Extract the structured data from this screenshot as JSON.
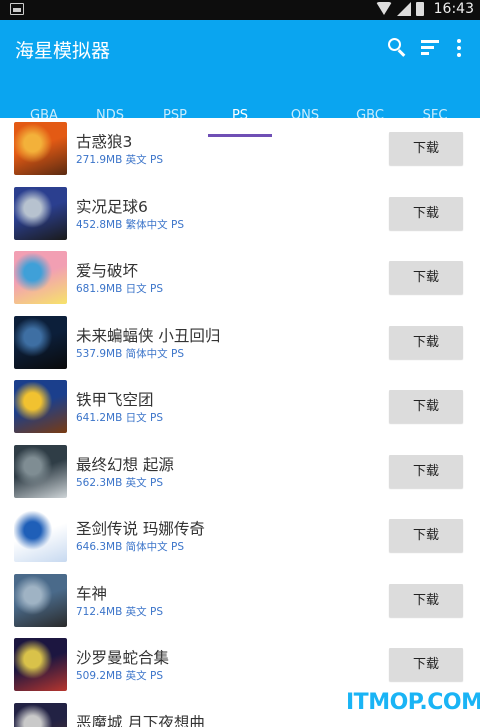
{
  "status_bar": {
    "time": "16:43"
  },
  "app_bar": {
    "title": "海星模拟器",
    "color": "#0aa5f0",
    "icons": [
      "search-icon",
      "sort-icon",
      "more-vert-icon"
    ]
  },
  "tabs": [
    {
      "label": "GBA",
      "active": false
    },
    {
      "label": "NDS",
      "active": false
    },
    {
      "label": "PSP",
      "active": false
    },
    {
      "label": "PS",
      "active": true
    },
    {
      "label": "ONS",
      "active": false
    },
    {
      "label": "GBC",
      "active": false
    },
    {
      "label": "SFC",
      "active": false
    }
  ],
  "download_label": "下载",
  "games": [
    {
      "name": "古惑狼3",
      "size": "271.9MB",
      "lang": "英文",
      "platform": "PS",
      "palette": [
        "#e35a14",
        "#f3b13a",
        "#5a2a12"
      ]
    },
    {
      "name": "实况足球6",
      "size": "452.8MB",
      "lang": "繁体中文",
      "platform": "PS",
      "palette": [
        "#2b3f8f",
        "#b7c2cf",
        "#1a1a1a"
      ]
    },
    {
      "name": "爱与破坏",
      "size": "681.9MB",
      "lang": "日文",
      "platform": "PS",
      "palette": [
        "#f29fb3",
        "#3fa0d8",
        "#f6e36a"
      ]
    },
    {
      "name": "未来蝙蝠侠 小丑回归",
      "size": "537.9MB",
      "lang": "简体中文",
      "platform": "PS",
      "palette": [
        "#0c1f3a",
        "#3e6fa3",
        "#0a0a0a"
      ]
    },
    {
      "name": "铁甲飞空团",
      "size": "641.2MB",
      "lang": "日文",
      "platform": "PS",
      "palette": [
        "#1b3f8c",
        "#f1c230",
        "#7a3b12"
      ]
    },
    {
      "name": "最终幻想 起源",
      "size": "562.3MB",
      "lang": "英文",
      "platform": "PS",
      "palette": [
        "#2f3d46",
        "#7f8d93",
        "#cfd5d8"
      ]
    },
    {
      "name": "圣剑传说 玛娜传奇",
      "size": "646.3MB",
      "lang": "简体中文",
      "platform": "PS",
      "palette": [
        "#ffffff",
        "#1f5fb8",
        "#c7d9f0"
      ]
    },
    {
      "name": "车神",
      "size": "712.4MB",
      "lang": "英文",
      "platform": "PS",
      "palette": [
        "#4a6a8a",
        "#9fb3c4",
        "#2a2a2a"
      ]
    },
    {
      "name": "沙罗曼蛇合集",
      "size": "509.2MB",
      "lang": "英文",
      "platform": "PS",
      "palette": [
        "#1c1640",
        "#d9c24a",
        "#b8362e"
      ]
    },
    {
      "name": "恶魔城 月下夜想曲",
      "size": "",
      "lang": "",
      "platform": "",
      "palette": [
        "#222244",
        "#c9c9c9",
        "#5a3a2a"
      ]
    }
  ],
  "watermark": "ITMOP.COM"
}
